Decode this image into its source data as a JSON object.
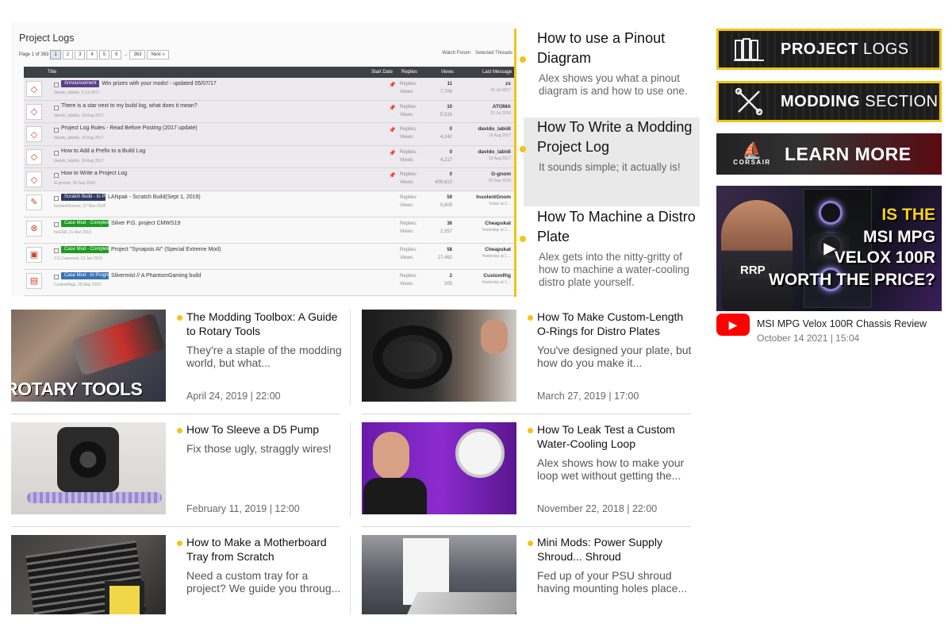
{
  "forum": {
    "title": "Project Logs",
    "pager_text": "Page 1 of 363",
    "pages": [
      "1",
      "2",
      "3",
      "4",
      "5",
      "6",
      "→",
      "363",
      "Next »"
    ],
    "actions": [
      "Watch Forum",
      "Selected Threads"
    ],
    "columns": [
      "Title",
      "Start Date",
      "Replies",
      "Views",
      "Last Message"
    ],
    "rows": [
      {
        "tag": "Announcement",
        "tag_color": "purple",
        "title": "Win prizes with your mods! - updated 05/07/17",
        "author": "davido_labidio, 5 Jul 2017",
        "replies_label": "Replies:",
        "replies": "11",
        "views_label": "Views:",
        "views": "7,700",
        "last_user": "zx",
        "last_time": "24 Jul 2017"
      },
      {
        "tag": "",
        "tag_color": "",
        "title": "There is a star next to my build log, what does it mean?",
        "author": "davido_labidio, 16 Aug 2017",
        "replies_label": "Replies:",
        "replies": "10",
        "views_label": "Views:",
        "views": "5,516",
        "last_user": "ATOMA",
        "last_time": "23 Jul 2018"
      },
      {
        "tag": "",
        "tag_color": "",
        "title": "Project Log Rules - Read Before Posting (2017 update)",
        "author": "davido_labidio, 16 Aug 2017",
        "replies_label": "Replies:",
        "replies": "0",
        "views_label": "Views:",
        "views": "4,242",
        "last_user": "davido_labidi",
        "last_time": "16 Aug 2017"
      },
      {
        "tag": "",
        "tag_color": "",
        "title": "How to Add a Prefix to a Build Log",
        "author": "davido_labidio, 16 Aug 2017",
        "replies_label": "Replies:",
        "replies": "0",
        "views_label": "Views:",
        "views": "4,217",
        "last_user": "davido_labidi",
        "last_time": "16 Aug 2017"
      },
      {
        "tag": "",
        "tag_color": "",
        "title": "How to Write a Project Log",
        "author": "G-gnome, 29 Sep 2016",
        "replies_label": "Replies:",
        "replies": "0",
        "views_label": "Views:",
        "views": "409,610",
        "last_user": "G-gnom",
        "last_time": "29 Sep 2016"
      },
      {
        "tag": "Scratch Build - In Progress ★",
        "tag_color": "navy",
        "title": "LANpak - Scratch Build(Sept 1, 2019)",
        "author": "InsolentGnome, 27 Nov 2018",
        "replies_label": "Replies:",
        "replies": "59",
        "views_label": "Views:",
        "views": "5,609",
        "last_user": "InsolentGnom",
        "last_time": "Today at 0…"
      },
      {
        "tag": "Case Mod - Complete",
        "tag_color": "green",
        "title": "Silver P.G. project CMWS19",
        "author": "heGSA, 21 Mar 2019",
        "replies_label": "Replies:",
        "replies": "36",
        "views_label": "Views:",
        "views": "2,557",
        "last_user": "Cheapskat",
        "last_time": "Yesterday at 1…"
      },
      {
        "tag": "Case Mod - Complete",
        "tag_color": "green",
        "title": "Project \"Synapsis AI\" (Special Extreme Mod)",
        "author": "Y.G Casemod, 13 Jan 2019",
        "replies_label": "Replies:",
        "replies": "58",
        "views_label": "Views:",
        "views": "27,462",
        "last_user": "Cheapskat",
        "last_time": "Yesterday at 1…"
      },
      {
        "tag": "Case Mod - In Progress",
        "tag_color": "blue",
        "title": "Silvermist // A PhantomGaming build",
        "author": "CustomRigs, 29 May 2019",
        "replies_label": "Replies:",
        "replies": "2",
        "views_label": "Views:",
        "views": "205",
        "last_user": "CustomRig",
        "last_time": "Yesterday at 1…"
      }
    ]
  },
  "timeline": [
    {
      "title": "How to use a Pinout Diagram",
      "desc": "Alex shows you what a pinout diagram is and how to use one."
    },
    {
      "title": "How To Write a Modding Project Log",
      "desc": "It sounds simple; it actually is!"
    },
    {
      "title": "How To Machine a Distro Plate",
      "desc": "Alex gets into the nitty-gritty of how to machine a water-cooling distro plate yourself."
    }
  ],
  "sidebar": {
    "banner_project_logs": {
      "bold": "PROJECT",
      "light": " LOGS"
    },
    "banner_modding": {
      "bold": "MODDING",
      "light": " SECTION"
    },
    "banner_corsair": {
      "brand": "CORSAIR",
      "text": "LEARN MORE"
    },
    "video": {
      "overlay_lines": [
        "IS THE",
        "MSI MPG",
        "VELOX 100R",
        "WORTH THE PRICE?"
      ],
      "badge": "RRP",
      "title": "MSI MPG Velox 100R Chassis Review",
      "date": "October 14 2021 | 15:04"
    }
  },
  "articles": [
    {
      "title": "The Modding Toolbox: A Guide to Rotary Tools",
      "desc": "They're a staple of the modding world, but what...",
      "date": "April 24, 2019 | 22:00",
      "thumb_label": "ROTARY TOOLS"
    },
    {
      "title": "How To Make Custom-Length O-Rings for Distro Plates",
      "desc": "You've designed your plate, but how do you make it...",
      "date": "March 27, 2019 | 17:00",
      "thumb_label": ""
    },
    {
      "title": "How To Sleeve a D5 Pump",
      "desc": "Fix those ugly, straggly wires!",
      "date": "February 11, 2019 | 12:00",
      "thumb_label": ""
    },
    {
      "title": "How To Leak Test a Custom Water-Cooling Loop",
      "desc": "Alex shows how to make your loop wet without getting the...",
      "date": "November 22, 2018 | 22:00",
      "thumb_label": ""
    },
    {
      "title": "How to Make a Motherboard Tray from Scratch",
      "desc": "Need a custom tray for a project? We guide you throug...",
      "date": "",
      "thumb_label": ""
    },
    {
      "title": "Mini Mods: Power Supply Shroud... Shroud",
      "desc": "Fed up of your PSU shroud having mounting holes place...",
      "date": "",
      "thumb_label": ""
    }
  ],
  "colors": {
    "accent": "#f2c318",
    "youtube": "#ff0000",
    "tag_green": "#1e9b22",
    "tag_blue": "#3c72b7",
    "tag_purple": "#5b3f8a"
  }
}
